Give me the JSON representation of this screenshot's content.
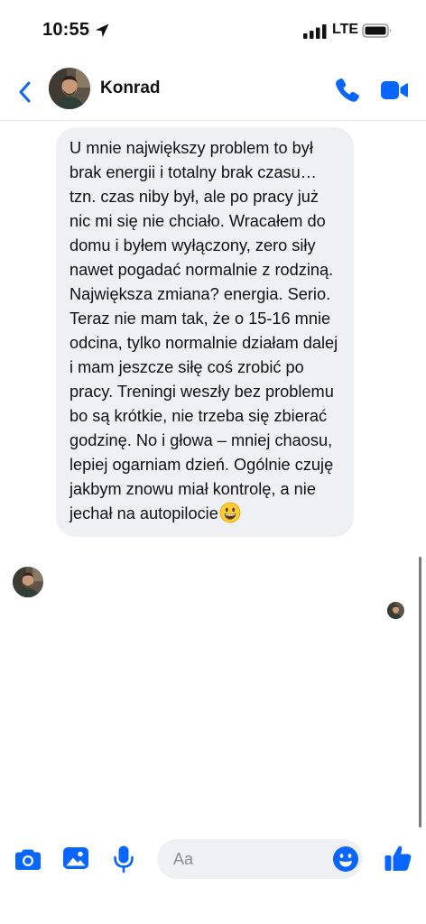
{
  "status_bar": {
    "time": "10:55",
    "carrier": "LTE",
    "icons": [
      "location-arrow-icon",
      "signal-bars-icon",
      "battery-icon"
    ]
  },
  "header": {
    "contact_name": "Konrad",
    "icons": [
      "back-chevron-icon",
      "avatar",
      "phone-call-icon",
      "video-call-icon"
    ]
  },
  "conversation": {
    "messages": [
      {
        "sender": "Konrad",
        "direction": "incoming",
        "text": "U mnie największy problem to był brak energii i totalny brak czasu… tzn. czas niby był, ale po pracy już nic mi się nie chciało. Wracałem do domu i byłem wyłączony, zero siły nawet pogadać normalnie z rodziną.\nNajwiększa zmiana? energia. Serio. Teraz nie mam tak, że o 15-16 mnie odcina, tylko normalnie działam dalej i mam jeszcze siłę coś zrobić po pracy. Treningi weszły bez problemu bo są krótkie, nie trzeba się zbierać godzinę. No i głowa – mniej chaosu, lepiej ogarniam dzień. Ogólnie czuję jakbym znowu miał kontrolę, a nie jechał na autopilocie",
        "trailing_emoji": "grinning-face-emoji"
      }
    ],
    "seen_indicator": "seen-avatar"
  },
  "composer": {
    "placeholder": "Aa",
    "value": "",
    "icons": [
      "camera-icon",
      "gallery-icon",
      "microphone-icon",
      "emoji-icon",
      "thumbs-up-icon"
    ]
  },
  "colors": {
    "accent": "#0866ff",
    "bubble_incoming": "#eff0f3",
    "background": "#ffffff",
    "text": "#111111"
  }
}
